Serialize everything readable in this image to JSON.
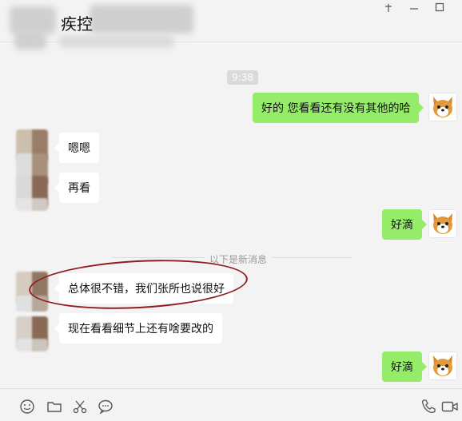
{
  "window": {
    "title": "疾控",
    "controls": {
      "pin": "⊥",
      "minimize": "—",
      "maximize": "☐"
    }
  },
  "chat": {
    "time_chip": "9:38",
    "messages": [
      {
        "side": "out",
        "text": "好的  您看看还有没有其他的哈"
      },
      {
        "side": "in",
        "text": "嗯嗯"
      },
      {
        "side": "in",
        "text": "再看"
      },
      {
        "side": "out",
        "text": "好滴"
      },
      {
        "side": "in",
        "text": "总体很不错，我们张所也说很好"
      },
      {
        "side": "in",
        "text": "现在看看细节上还有啥要改的"
      },
      {
        "side": "out",
        "text": "好滴"
      }
    ],
    "divider_label": "以下是新消息"
  },
  "toolbar": {
    "icons": [
      "emoji-icon",
      "folder-icon",
      "scissors-icon",
      "chat-bubble-icon",
      "phone-icon",
      "video-icon"
    ]
  },
  "colors": {
    "background": "#f3f3f3",
    "incoming_bubble": "#ffffff",
    "outgoing_bubble": "#95ec69",
    "highlight_oval": "#8f1d1d"
  }
}
